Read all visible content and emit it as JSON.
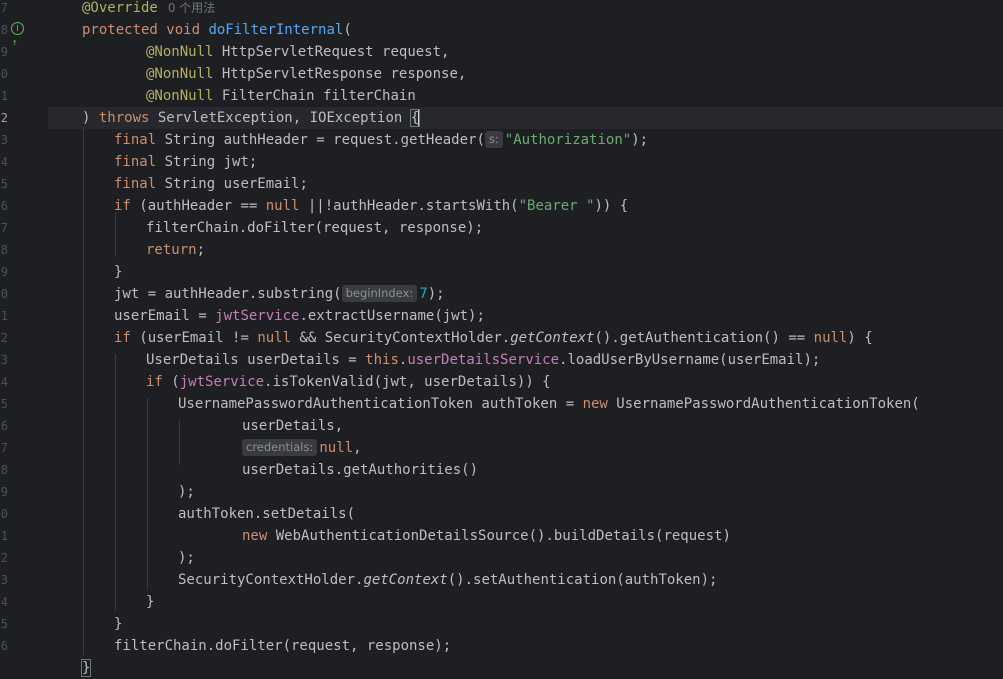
{
  "editor": {
    "line_numbers": [
      "7",
      "8",
      "9",
      "0",
      "1",
      "2",
      "3",
      "4",
      "5",
      "6",
      "7",
      "8",
      "9",
      "0",
      "1",
      "2",
      "3",
      "4",
      "5",
      "6",
      "7",
      "8",
      "9",
      "0",
      "1",
      "2",
      "3",
      "4",
      "5",
      "6"
    ],
    "gutter_icon": "override-implementation-icon",
    "current_line_index": 5,
    "usages_hint": "0 个用法",
    "hints": {
      "s": "s:",
      "beginIndex": "beginIndex:",
      "credentials": "credentials:"
    },
    "tokens": {
      "override": "@Override",
      "protected": "protected",
      "void": "void",
      "doFilterInternal": "doFilterInternal",
      "nonnull": "@NonNull",
      "HttpServletRequest": "HttpServletRequest",
      "request_param": "request,",
      "HttpServletResponse": "HttpServletResponse",
      "response_param": "response,",
      "FilterChain": "FilterChain",
      "filterChain_param": "filterChain",
      "throws": "throws",
      "exceptions": "ServletException, IOException ",
      "final": "final",
      "authHeader_decl": "String authHeader = request.getHeader(",
      "authorization_str": "\"Authorization\"",
      "close_semicolon": ");",
      "jwt_decl": "String jwt;",
      "userEmail_decl": "String userEmail;",
      "if": "if",
      "authHeader_eq": "(authHeader == ",
      "null": "null",
      "or_not_starts": " ||!authHeader.startsWith(",
      "bearer_str": "\"Bearer \"",
      "close_paren_brace": ")) {",
      "filter_call": "filterChain.doFilter(request, response);",
      "return": "return",
      "semicolon": ";",
      "close_brace": "}",
      "jwt_assign": "jwt = authHeader.substring(",
      "seven": "7",
      "userEmail_assign": "userEmail = ",
      "jwtService": "jwtService",
      "extract_call": ".extractUsername(jwt);",
      "userEmail_neq": "(userEmail != ",
      "and_sch": " && SecurityContextHolder.",
      "getContext": "getContext",
      "getAuth": "().getAuthentication() == ",
      "paren_brace": ") {",
      "userDetails_decl": "UserDetails userDetails = ",
      "this": "this",
      "dot": ".",
      "userDetailsService": "userDetailsService",
      "load_call": ".loadUserByUsername(userEmail);",
      "isTokenValid": ".isTokenValid(jwt, userDetails)) {",
      "open_paren": "(",
      "upat_decl": "UsernamePasswordAuthenticationToken authToken = ",
      "new": "new",
      "upat_ctor": " UsernamePasswordAuthenticationToken(",
      "userDetails_arg": "userDetails,",
      "comma": ",",
      "getAuthorities": "userDetails.getAuthorities()",
      "setDetails": "authToken.setDetails(",
      "wads": " WebAuthenticationDetailsSource().buildDetails(request)",
      "sch": "SecurityContextHolder.",
      "setAuth": "().setAuthentication(authToken);",
      "brace_open": "{"
    }
  }
}
